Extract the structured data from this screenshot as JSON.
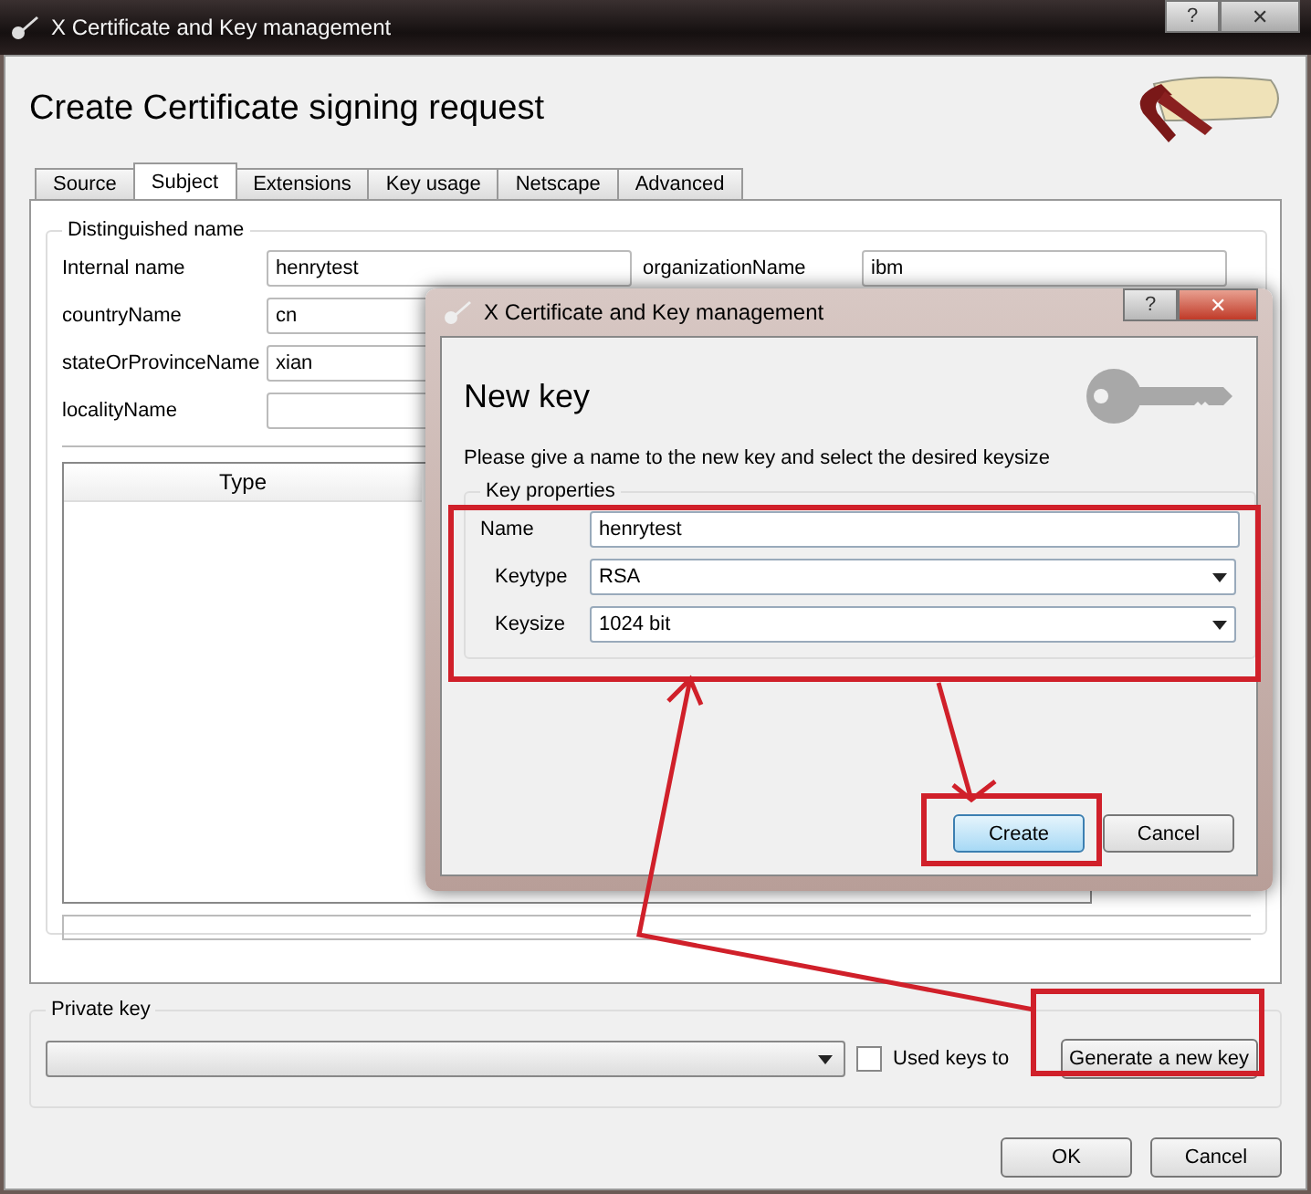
{
  "window": {
    "title": "X Certificate and Key management",
    "help": "?",
    "close": "✕"
  },
  "heading": "Create Certificate signing request",
  "tabs": [
    {
      "label": "Source",
      "selected": false
    },
    {
      "label": "Subject",
      "selected": true
    },
    {
      "label": "Extensions",
      "selected": false
    },
    {
      "label": "Key usage",
      "selected": false
    },
    {
      "label": "Netscape",
      "selected": false
    },
    {
      "label": "Advanced",
      "selected": false
    }
  ],
  "distinguished_name": {
    "title": "Distinguished name",
    "left_fields": [
      {
        "label": "Internal name",
        "value": "henrytest"
      },
      {
        "label": "countryName",
        "value": "cn"
      },
      {
        "label": "stateOrProvinceName",
        "value": "xian"
      },
      {
        "label": "localityName"
      }
    ],
    "right_fields": [
      {
        "label": "organizationName",
        "value": "ibm"
      }
    ],
    "table": {
      "columns": [
        "Type"
      ]
    }
  },
  "private_key": {
    "title": "Private key",
    "checkbox": {
      "label": "Used keys to",
      "checked": false
    },
    "button": "Generate a new key"
  },
  "buttons": [
    {
      "label": "OK"
    },
    {
      "label": "Cancel"
    }
  ],
  "dialog": {
    "title": "X Certificate and Key management",
    "help": "?",
    "close": "✕",
    "heading": "New key",
    "description": "Please give a name to the new key and select the desired keysize",
    "group": "Key properties",
    "fields": [
      {
        "label": "Name",
        "kind": "input",
        "value": "henrytest"
      },
      {
        "label": "Keytype",
        "kind": "combo",
        "value": "RSA"
      },
      {
        "label": "Keysize",
        "kind": "combo",
        "value": "1024 bit"
      }
    ],
    "buttons": [
      {
        "label": "Create",
        "default": true
      },
      {
        "label": "Cancel",
        "default": false
      }
    ]
  }
}
